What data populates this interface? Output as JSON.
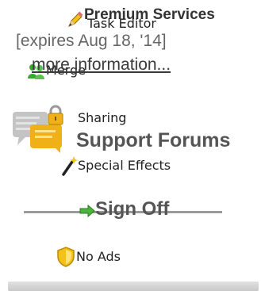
{
  "premium": {
    "title": "Premium Services",
    "expires": "[expires Aug 18, '14]",
    "more_info": "more information..."
  },
  "menu": {
    "task_editor": "Task Editor",
    "merge": "Merge",
    "sharing": "Sharing",
    "support_forums": "Support Forums",
    "special_effects": "Special Effects",
    "sign_off": "Sign Off",
    "no_ads": "No Ads"
  },
  "icons": {
    "task_editor": "pencil-icon",
    "merge": "merge-users-icon",
    "sharing": "lock-icon",
    "support_forums": "speech-bubbles-icon",
    "special_effects": "magic-wand-icon",
    "sign_off": "arrow-right-icon",
    "no_ads": "shield-icon"
  },
  "colors": {
    "accent_green": "#3aa832",
    "accent_yellow": "#f2c21a"
  }
}
